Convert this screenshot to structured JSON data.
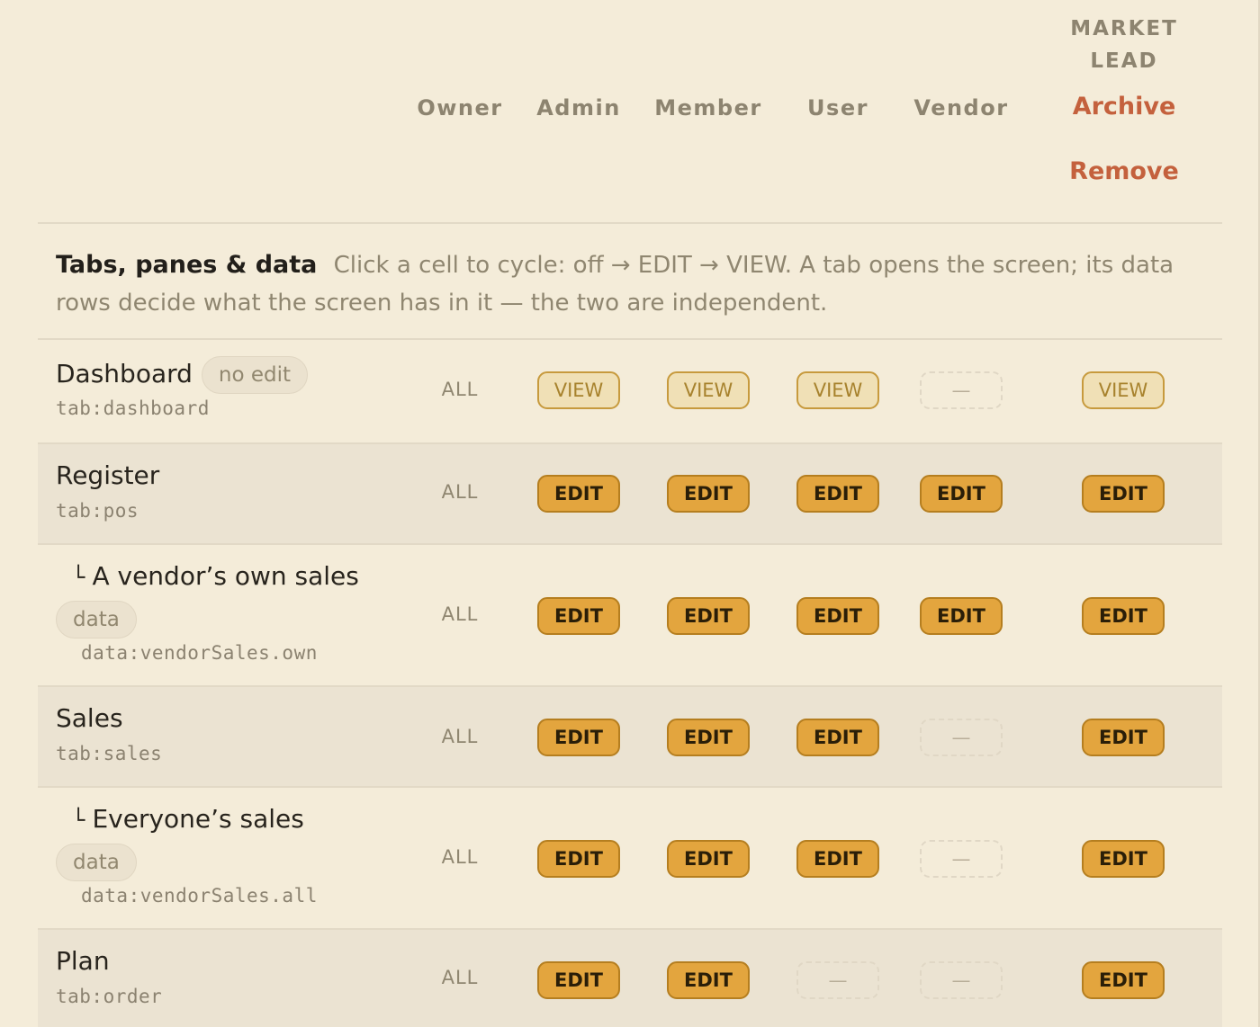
{
  "columns": {
    "owner": "Owner",
    "admin": "Admin",
    "member": "Member",
    "user": "User",
    "vendor": "Vendor"
  },
  "market": {
    "name": "MARKET LEAD",
    "archive_label": "Archive",
    "remove_label": "Remove"
  },
  "section": {
    "title": "Tabs, panes & data",
    "description": "Click a cell to cycle: off → EDIT → VIEW. A tab opens the screen; its data rows decide what the screen has in it — the two are independent."
  },
  "labels": {
    "sub_mark": "└",
    "data_badge": "data"
  },
  "rows": [
    {
      "name": "Dashboard",
      "badge": "no edit",
      "key": "tab:dashboard",
      "owner": "ALL",
      "admin": "VIEW",
      "member": "VIEW",
      "user": "VIEW",
      "vendor": "—",
      "market": "VIEW"
    },
    {
      "name": "Register",
      "key": "tab:pos",
      "owner": "ALL",
      "admin": "EDIT",
      "member": "EDIT",
      "user": "EDIT",
      "vendor": "EDIT",
      "market": "EDIT"
    },
    {
      "name": "A vendor’s own sales",
      "key": "data:vendorSales.own",
      "owner": "ALL",
      "admin": "EDIT",
      "member": "EDIT",
      "user": "EDIT",
      "vendor": "EDIT",
      "market": "EDIT"
    },
    {
      "name": "Sales",
      "key": "tab:sales",
      "owner": "ALL",
      "admin": "EDIT",
      "member": "EDIT",
      "user": "EDIT",
      "vendor": "—",
      "market": "EDIT"
    },
    {
      "name": "Everyone’s sales",
      "key": "data:vendorSales.all",
      "owner": "ALL",
      "admin": "EDIT",
      "member": "EDIT",
      "user": "EDIT",
      "vendor": "—",
      "market": "EDIT"
    },
    {
      "name": "Plan",
      "key": "tab:order",
      "owner": "ALL",
      "admin": "EDIT",
      "member": "EDIT",
      "user": "—",
      "vendor": "—",
      "market": "EDIT"
    }
  ]
}
